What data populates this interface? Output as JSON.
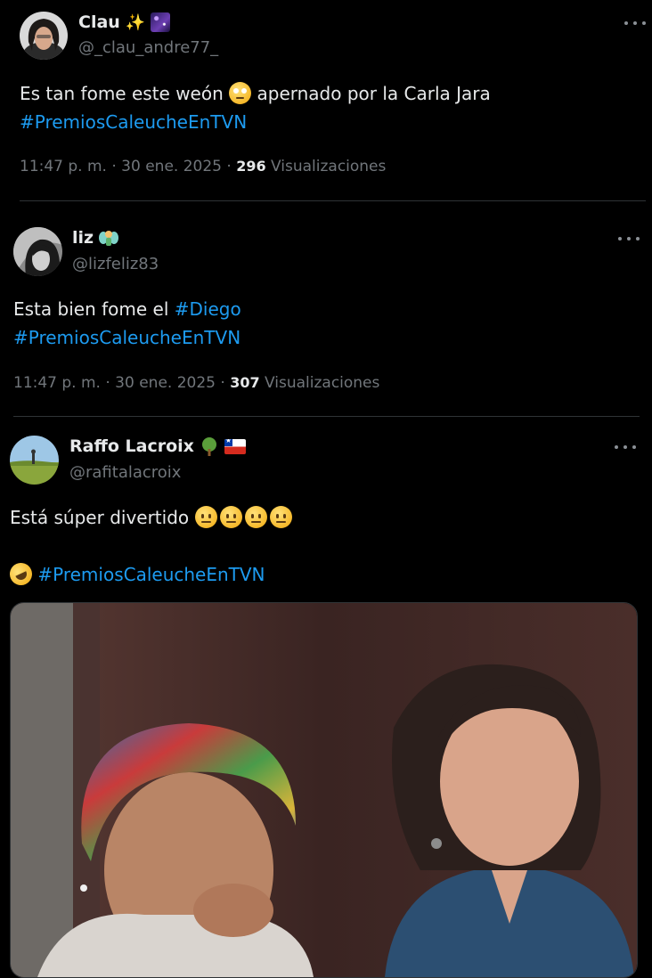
{
  "tweets": [
    {
      "display_name": "Clau",
      "name_emojis": [
        "sparkles",
        "milky-way"
      ],
      "handle": "@_clau_andre77_",
      "text_before": "Es tan fome este weón",
      "text_emoji": "face-with-rolling-eyes",
      "text_after": "apernado por la Carla Jara",
      "hashtag": "#PremiosCaleucheEnTVN",
      "timestamp": "11:47 p. m. · 30 ene. 2025 ·",
      "views": "296",
      "views_label": "Visualizaciones"
    },
    {
      "display_name": "liz",
      "name_emojis": [
        "fairy"
      ],
      "handle": "@lizfeliz83",
      "text_before": "Esta bien fome el",
      "hashtag_inline": "#Diego",
      "hashtag": "#PremiosCaleucheEnTVN",
      "timestamp": "11:47 p. m. · 30 ene. 2025 ·",
      "views": "307",
      "views_label": "Visualizaciones"
    },
    {
      "display_name": "Raffo Lacroix",
      "name_emojis": [
        "deciduous-tree",
        "flag-chile"
      ],
      "handle": "@rafitalacroix",
      "text_before": "Está súper divertido",
      "text_emojis": [
        "neutral-face",
        "neutral-face",
        "neutral-face",
        "neutral-face"
      ],
      "hashtag_emoji": "rolling-on-the-floor-laughing",
      "hashtag": "#PremiosCaleucheEnTVN",
      "media": "video-still"
    }
  ],
  "colors": {
    "background": "#000000",
    "text": "#e7e9ea",
    "secondary": "#71767b",
    "link": "#1d9bf0",
    "divider": "#2f3336"
  }
}
